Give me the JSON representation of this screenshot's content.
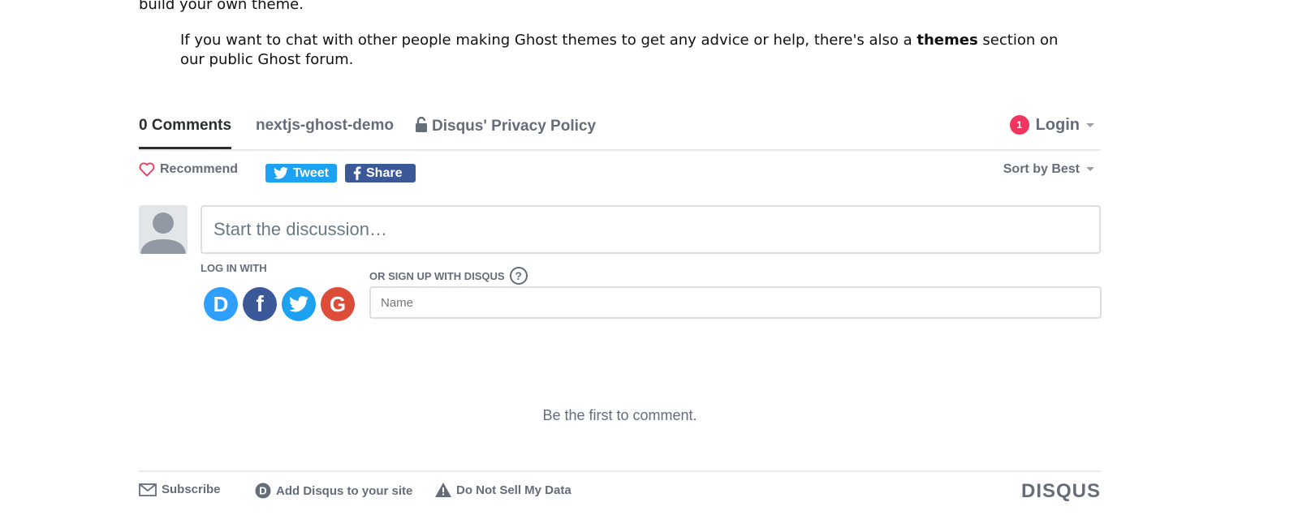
{
  "article": {
    "line_top": "build your own theme.",
    "quote_part1": "If you want to chat with other people making Ghost themes to get any advice or help, there's also a ",
    "quote_bold": "themes",
    "quote_part2": " section on our public Ghost forum."
  },
  "disqus": {
    "nav": {
      "comments_tab": "0 Comments",
      "site_tab": "nextjs-ghost-demo",
      "privacy_tab": "Disqus' Privacy Policy",
      "badge_count": "1",
      "login_label": "Login"
    },
    "toolbar": {
      "recommend_label": "Recommend",
      "tweet_label": "Tweet",
      "share_label": "Share",
      "sort_label": "Sort by Best"
    },
    "composer": {
      "placeholder": "Start the discussion…",
      "login_with_label": "LOG IN WITH",
      "signup_label": "OR SIGN UP WITH DISQUS",
      "help_icon_char": "?",
      "name_placeholder": "Name"
    },
    "social": {
      "disqus_letter": "D",
      "facebook_letter": "f",
      "google_letter": "G"
    },
    "empty_message": "Be the first to comment.",
    "footer": {
      "subscribe_label": "Subscribe",
      "add_disqus_label": "Add Disqus to your site",
      "do_not_sell_label": "Do Not Sell My Data",
      "logo_text": "DISQUS"
    }
  }
}
